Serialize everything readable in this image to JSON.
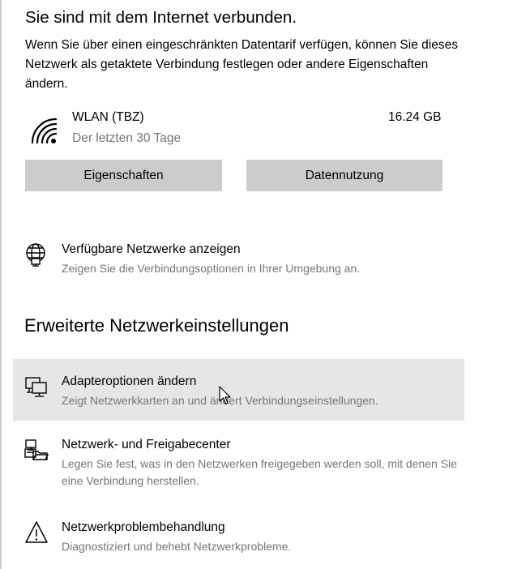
{
  "status": {
    "title": "Sie sind mit dem Internet verbunden.",
    "description": "Wenn Sie über einen eingeschränkten Datentarif verfügen, können Sie dieses Netzwerk als getaktete Verbindung festlegen oder andere Eigenschaften ändern."
  },
  "network": {
    "icon": "wifi-icon",
    "name": "WLAN (TBZ)",
    "period": "Der letzten 30 Tage",
    "usage": "16.24 GB"
  },
  "buttons": {
    "properties": "Eigenschaften",
    "data_usage": "Datennutzung"
  },
  "available_networks": {
    "icon": "globe-icon",
    "title": "Verfügbare Netzwerke anzeigen",
    "subtitle": "Zeigen Sie die Verbindungsoptionen in Ihrer Umgebung an."
  },
  "advanced": {
    "heading": "Erweiterte Netzwerkeinstellungen",
    "items": [
      {
        "icon": "network-adapter-icon",
        "title": "Adapteroptionen ändern",
        "subtitle": "Zeigt Netzwerkkarten an und ändert Verbindungseinstellungen.",
        "hovered": true
      },
      {
        "icon": "sharing-center-icon",
        "title": "Netzwerk- und Freigabecenter",
        "subtitle": "Legen Sie fest, was in den Netzwerken freigegeben werden soll, mit denen Sie eine Verbindung herstellen."
      },
      {
        "icon": "warning-icon",
        "title": "Netzwerkproblembehandlung",
        "subtitle": "Diagnostiziert und behebt Netzwerkprobleme."
      }
    ]
  },
  "colors": {
    "button_bg": "#cccccc",
    "hover_bg": "#e6e6e6",
    "secondary_text": "#767676"
  }
}
